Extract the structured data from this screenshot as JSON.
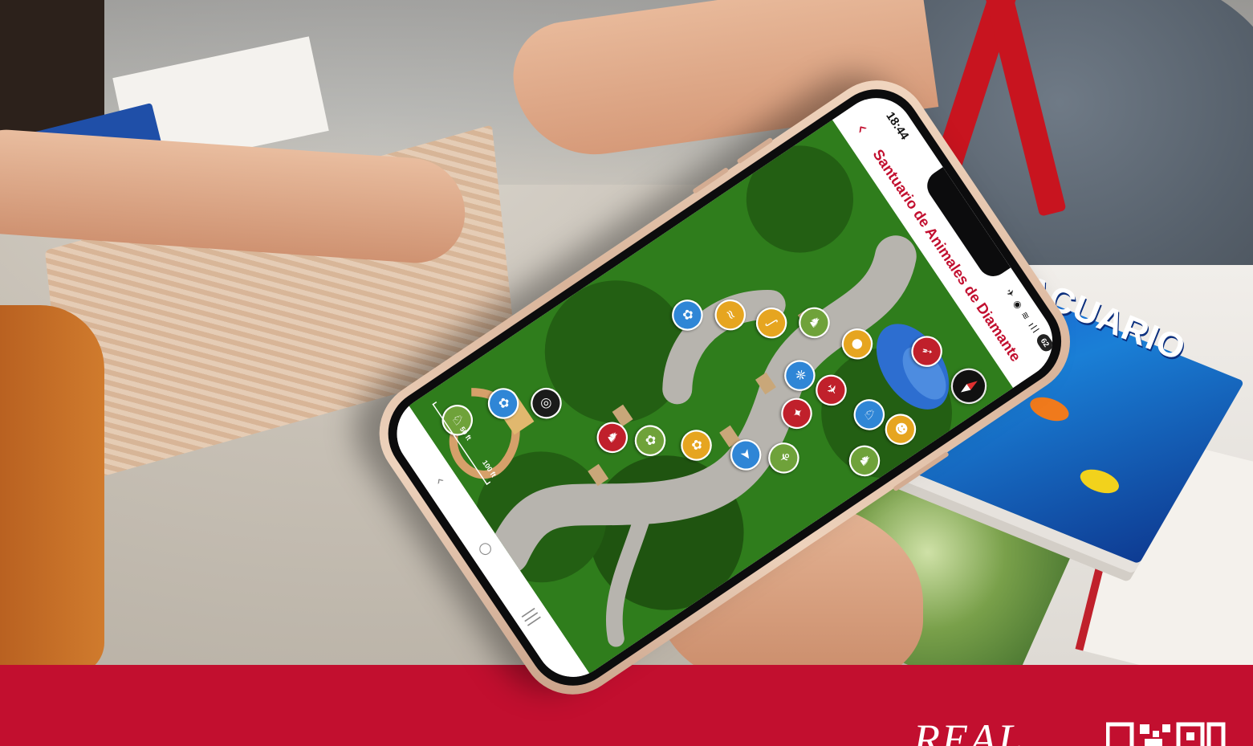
{
  "phone": {
    "status": {
      "time": "18:44",
      "icons": "✈ ◉ ≋ ıll",
      "battery": "62"
    },
    "header": {
      "back_icon": "‹",
      "title": "Santuario de Animales de Diamante"
    },
    "map": {
      "scale_labels": [
        "50 ft",
        "100 ft"
      ],
      "compass_icon": "compass-icon"
    },
    "nav": {
      "recents": "|||",
      "home": "○",
      "back": "‹"
    },
    "poi_icons": [
      "bird-icon",
      "turtle-icon",
      "deer-icon",
      "snake-icon",
      "crocodile-icon",
      "paw-icon",
      "butterfly-icon",
      "parrot-icon",
      "toucan-icon",
      "wolf-icon",
      "monkey-icon",
      "zebra-icon",
      "flamingo-icon",
      "fish-icon",
      "logo-icon",
      "horse-icon",
      "gazelle-icon",
      "cat-icon"
    ]
  },
  "background": {
    "brochure_title": "ACUARIO",
    "brand_logo": "REAL",
    "brand_color": "#c20f2f"
  },
  "colors": {
    "accent_red": "#c20f2f",
    "map_green": "#2f7d1c",
    "path_gray": "#b7b4ae",
    "water_blue": "#2d6ed0"
  }
}
